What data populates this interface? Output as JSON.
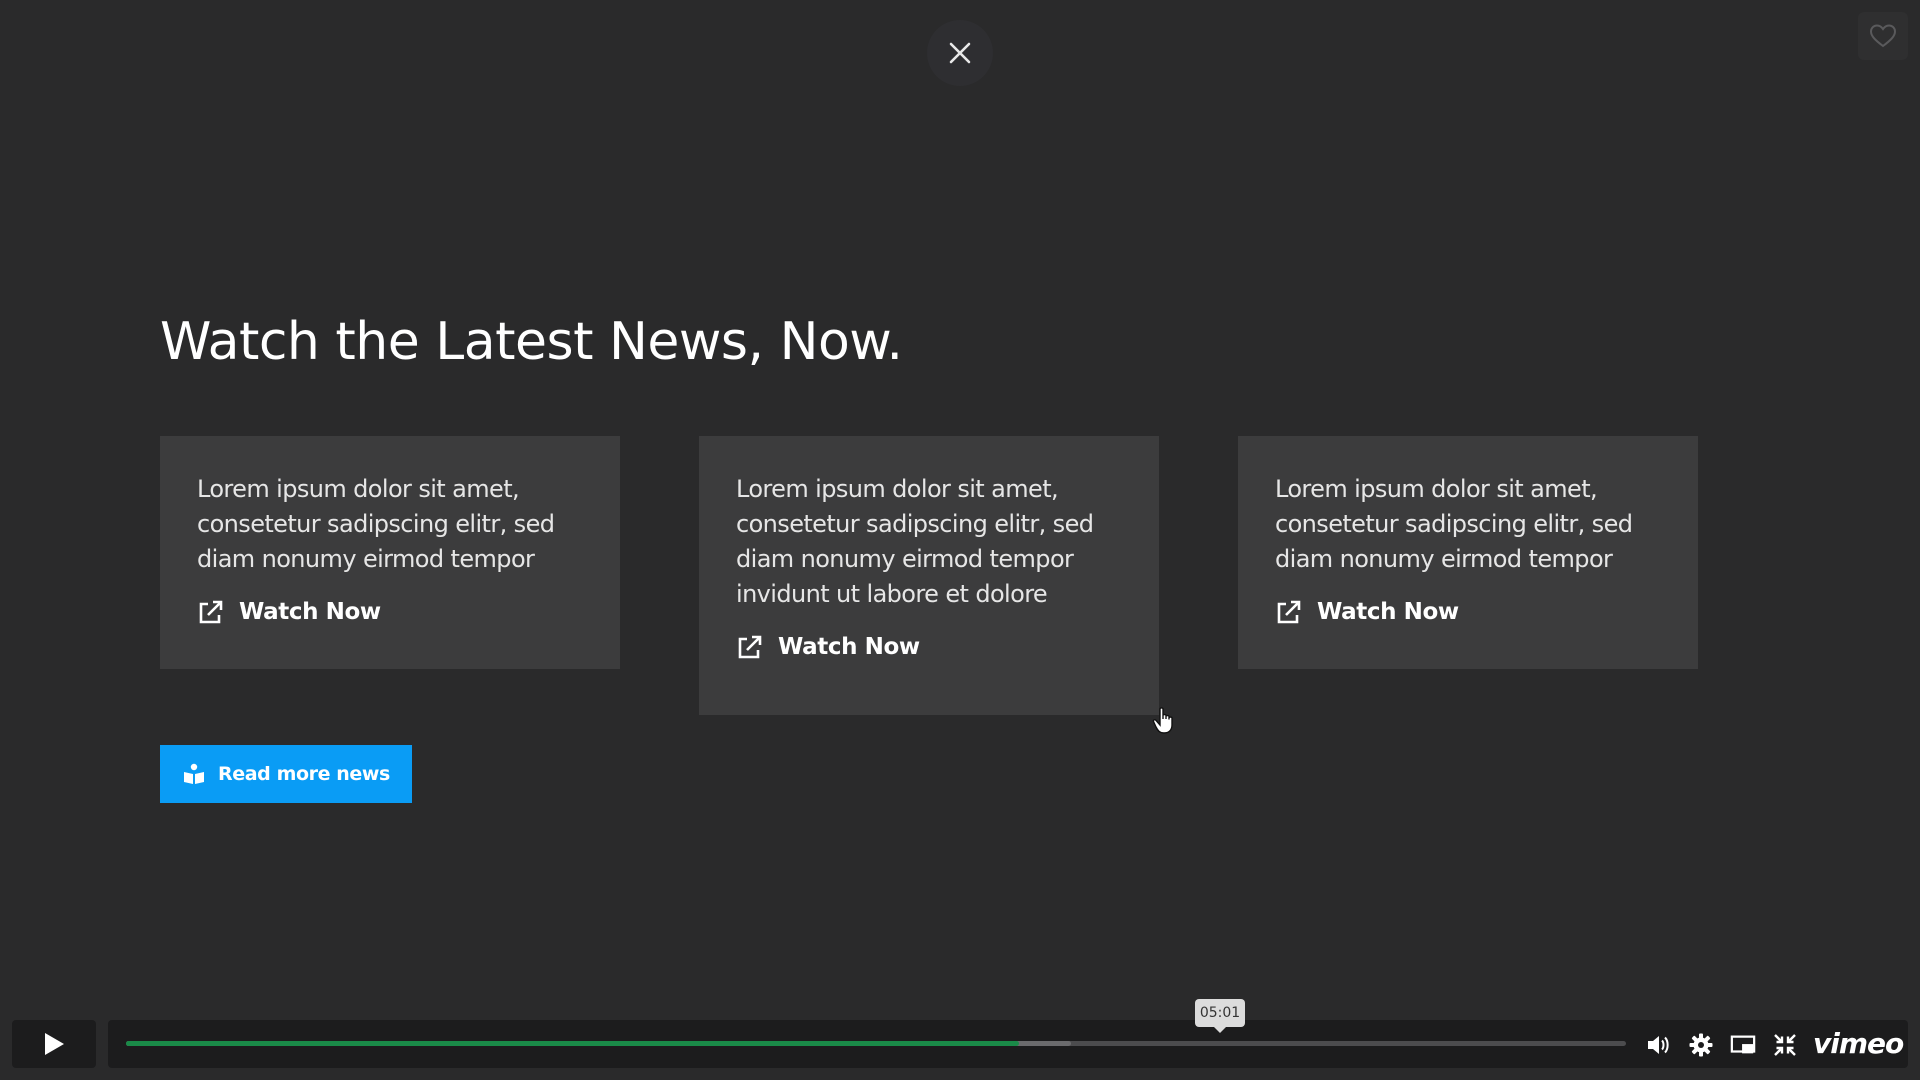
{
  "overlay": {
    "headline": "Watch the Latest News, Now.",
    "cards": [
      {
        "text": "Lorem ipsum dolor sit amet, consetetur sadipscing elitr, sed diam nonumy eirmod tempor",
        "link_label": "Watch Now"
      },
      {
        "text": "Lorem ipsum dolor sit amet, consetetur sadipscing elitr, sed diam nonumy eirmod tempor invidunt ut labore et dolore",
        "link_label": "Watch Now"
      },
      {
        "text": "Lorem ipsum dolor sit amet, consetetur sadipscing elitr, sed diam nonumy eirmod tempor",
        "link_label": "Watch Now"
      }
    ],
    "read_more_label": "Read more news"
  },
  "player": {
    "hover_time": "05:01",
    "played_fraction": 0.595,
    "buffered_fraction": 0.63,
    "logo": "vimeo",
    "icons": [
      "play-icon",
      "volume-icon",
      "settings-icon",
      "picture-in-picture-icon",
      "exit-fullscreen-icon"
    ]
  },
  "colors": {
    "background": "#2a2a2b",
    "card": "#3c3c3d",
    "accent": "#0a9cf5",
    "progress_played": "#1a8a48"
  }
}
